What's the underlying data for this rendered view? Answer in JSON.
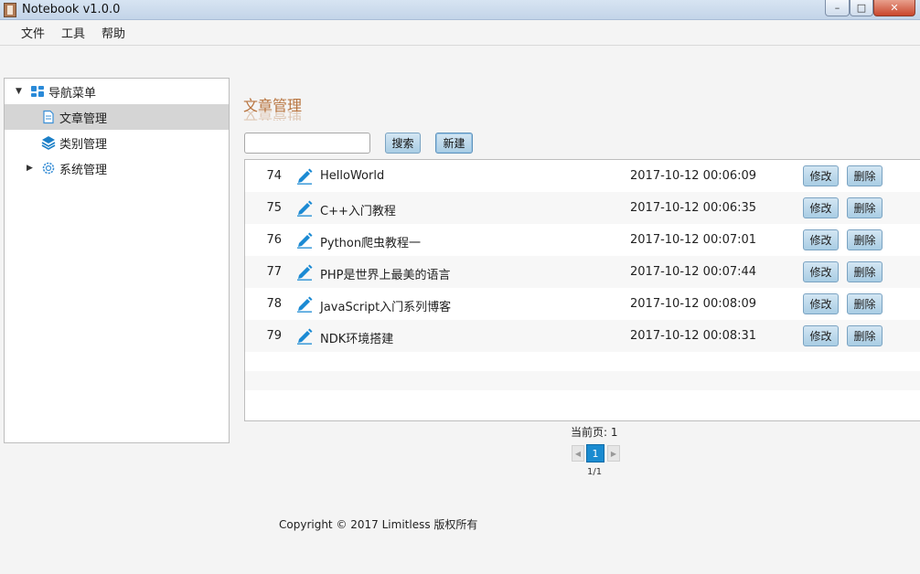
{
  "window": {
    "title": "Notebook v1.0.0",
    "controls": {
      "min": "–",
      "max": "□",
      "close": "✕"
    }
  },
  "menu": [
    "文件",
    "工具",
    "帮助"
  ],
  "sidebar": {
    "items": [
      {
        "label": "导航菜单",
        "icon": "grid-icon",
        "arrow": "▼"
      },
      {
        "label": "文章管理",
        "icon": "document-icon"
      },
      {
        "label": "类别管理",
        "icon": "layers-icon"
      },
      {
        "label": "系统管理",
        "icon": "gear-icon",
        "arrow": "▶"
      }
    ]
  },
  "main": {
    "title": "文章管理",
    "search_placeholder": "",
    "search_button": "搜索",
    "new_button": "新建"
  },
  "articles": [
    {
      "id": "74",
      "title": "HelloWorld",
      "date": "2017-10-12 00:06:09",
      "edit": "修改",
      "delete": "删除"
    },
    {
      "id": "75",
      "title": "C++入门教程",
      "date": "2017-10-12 00:06:35",
      "edit": "修改",
      "delete": "删除"
    },
    {
      "id": "76",
      "title": "Python爬虫教程一",
      "date": "2017-10-12 00:07:01",
      "edit": "修改",
      "delete": "删除"
    },
    {
      "id": "77",
      "title": "PHP是世界上最美的语言",
      "date": "2017-10-12 00:07:44",
      "edit": "修改",
      "delete": "删除"
    },
    {
      "id": "78",
      "title": "JavaScript入门系列博客",
      "date": "2017-10-12 00:08:09",
      "edit": "修改",
      "delete": "删除"
    },
    {
      "id": "79",
      "title": "NDK环境搭建",
      "date": "2017-10-12 00:08:31",
      "edit": "修改",
      "delete": "删除"
    }
  ],
  "pagination": {
    "current_label": "当前页: 1",
    "current": "1",
    "info": "1/1",
    "prev": "◀",
    "next": "▶"
  },
  "footer": {
    "copyright": "Copyright © 2017 Limitless 版权所有"
  },
  "colors": {
    "accent": "#1a8bd0",
    "title": "#b8743f",
    "button": "#a9cde4"
  }
}
